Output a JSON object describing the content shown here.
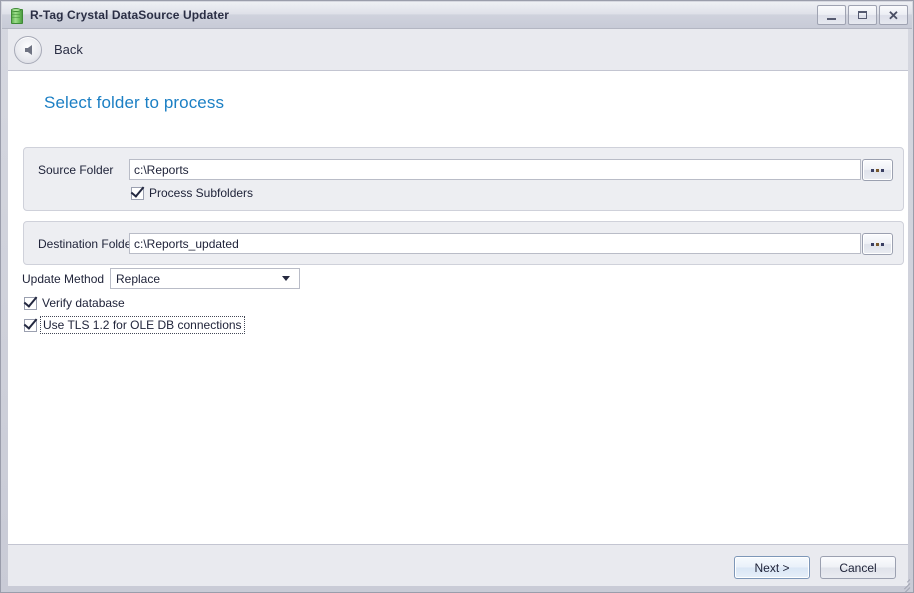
{
  "window": {
    "title": "R-Tag Crystal DataSource Updater",
    "icon": "database-cylinder-icon",
    "controls": {
      "minimize": "–",
      "maximize": "□",
      "close": "✕"
    }
  },
  "navigation": {
    "back_label": "Back",
    "back_icon": "arrow-left-circle-icon"
  },
  "page": {
    "title": "Select folder to process"
  },
  "source": {
    "label": "Source Folder",
    "path_value": "c:\\Reports",
    "browse_label": "...",
    "subfolders_label": "Process Subfolders",
    "subfolders_checked": true
  },
  "destination": {
    "label": "Destination Folder",
    "path_value": "c:\\Reports_updated",
    "browse_label": "..."
  },
  "options": {
    "update_method_label": "Update Method",
    "update_method_value": "Replace",
    "update_method_options": [
      "Replace"
    ],
    "verify_database_label": "Verify database",
    "verify_database_checked": true,
    "tls_label": "Use TLS 1.2 for OLE DB connections",
    "tls_checked": true
  },
  "footer": {
    "next_label": "Next >",
    "cancel_label": "Cancel"
  },
  "colors": {
    "accent_heading": "#1b7fc4",
    "titlebar_text": "#2b2f45",
    "group_background": "#edeef2",
    "default_button_border": "#7d97b8"
  }
}
